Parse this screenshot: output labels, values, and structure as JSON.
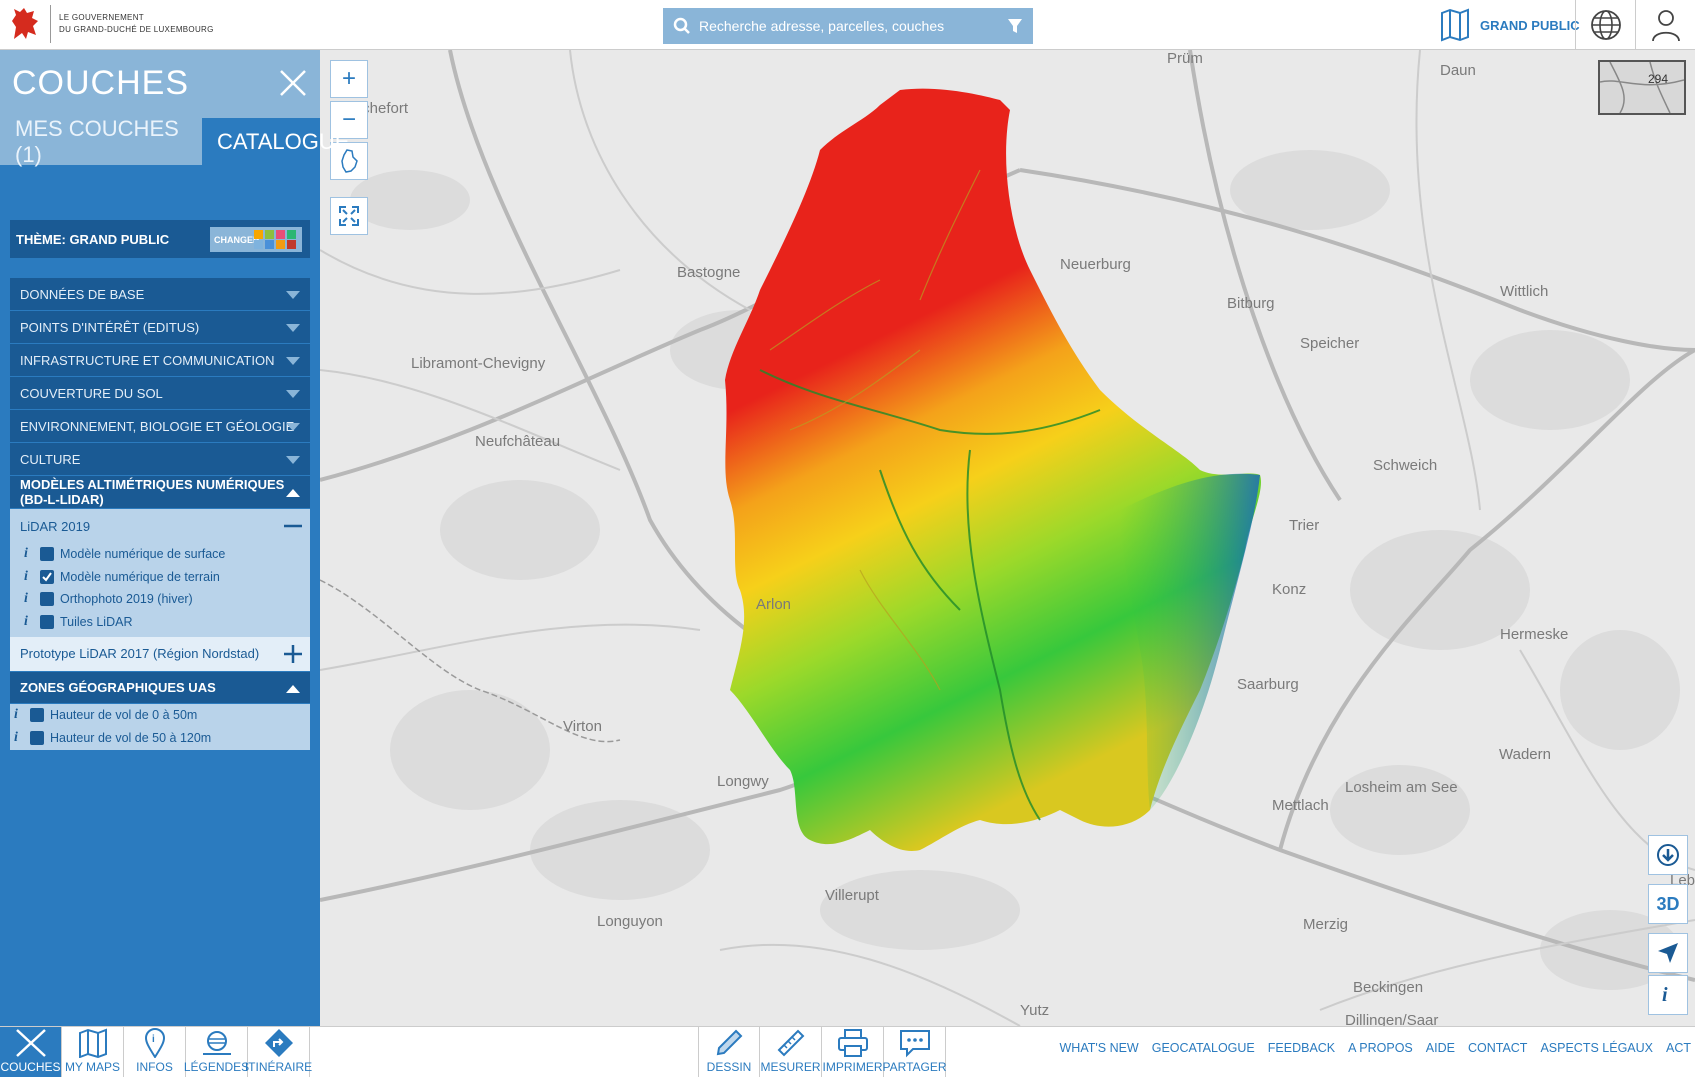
{
  "header": {
    "gov_line1": "LE GOUVERNEMENT",
    "gov_line2": "DU GRAND-DUCHÉ DE LUXEMBOURG",
    "search_placeholder": "Recherche adresse, parcelles, couches",
    "theme_label": "GRAND PUBLIC"
  },
  "sidebar": {
    "title": "COUCHES",
    "tabs": [
      {
        "label": "MES COUCHES (1)"
      },
      {
        "label": "CATALOGUE"
      }
    ],
    "theme": {
      "label": "THÈME: GRAND PUBLIC",
      "change_label": "CHANGER"
    },
    "categories": [
      {
        "label": "DONNÉES DE BASE"
      },
      {
        "label": "POINTS D'INTÉRÊT (EDITUS)"
      },
      {
        "label": "INFRASTRUCTURE ET COMMUNICATION"
      },
      {
        "label": "COUVERTURE DU SOL"
      },
      {
        "label": "ENVIRONNEMENT, BIOLOGIE ET GÉOLOGIE"
      },
      {
        "label": "CULTURE"
      },
      {
        "label": "MODÈLES ALTIMÉTRIQUES NUMÉRIQUES (BD-L-LIDAR)"
      },
      {
        "label": "ZONES GÉOGRAPHIQUES UAS"
      }
    ],
    "lidar2019": {
      "label": "LiDAR 2019",
      "layers": [
        {
          "label": "Modèle numérique de surface",
          "checked": false
        },
        {
          "label": "Modèle numérique de terrain",
          "checked": true
        },
        {
          "label": "Orthophoto 2019 (hiver)",
          "checked": false
        },
        {
          "label": "Tuiles LiDAR",
          "checked": false
        }
      ]
    },
    "prototype": {
      "label": "Prototype LiDAR 2017 (Région Nordstad)"
    },
    "uas_layers": [
      {
        "label": "Hauteur de vol de 0 à 50m",
        "checked": false
      },
      {
        "label": "Hauteur de vol de 50 à 120m",
        "checked": false
      }
    ]
  },
  "map": {
    "places": [
      "Prüm",
      "Rochefort",
      "Daun",
      "Bastogne",
      "Neuerburg",
      "Bitburg",
      "Wittlich",
      "Libramont-Chevigny",
      "Speicher",
      "Neufchâteau",
      "Schweich",
      "Trier",
      "Konz",
      "Arlon",
      "Hermeske",
      "Saarburg",
      "Virton",
      "Wadern",
      "Longwy",
      "Losheim am See",
      "Mettlach",
      "Villerupt",
      "Longuyon",
      "Merzig",
      "Lebac",
      "Beckingen",
      "Yutz",
      "Dillingen/Saar"
    ],
    "minimap_label": "294",
    "btn_3d": "3D"
  },
  "bottom": {
    "left": [
      {
        "label": "COUCHES"
      },
      {
        "label": "MY MAPS"
      },
      {
        "label": "INFOS"
      },
      {
        "label": "LÉGENDES"
      },
      {
        "label": "ITINÉRAIRE"
      }
    ],
    "tools": [
      {
        "label": "DESSIN"
      },
      {
        "label": "MESURER"
      },
      {
        "label": "IMPRIMER"
      },
      {
        "label": "PARTAGER"
      }
    ],
    "links": [
      "WHAT'S NEW",
      "GEOCATALOGUE",
      "FEEDBACK",
      "A PROPOS",
      "AIDE",
      "CONTACT",
      "ASPECTS LÉGAUX",
      "ACT"
    ]
  },
  "colors": {
    "primary": "#2b7bbf",
    "light": "#8ab5d8",
    "dark": "#1a5a94",
    "elev_high": "#e8231b",
    "elev_mid": "#f4c20d",
    "elev_low": "#37c83c",
    "elev_water": "#1565c0"
  }
}
